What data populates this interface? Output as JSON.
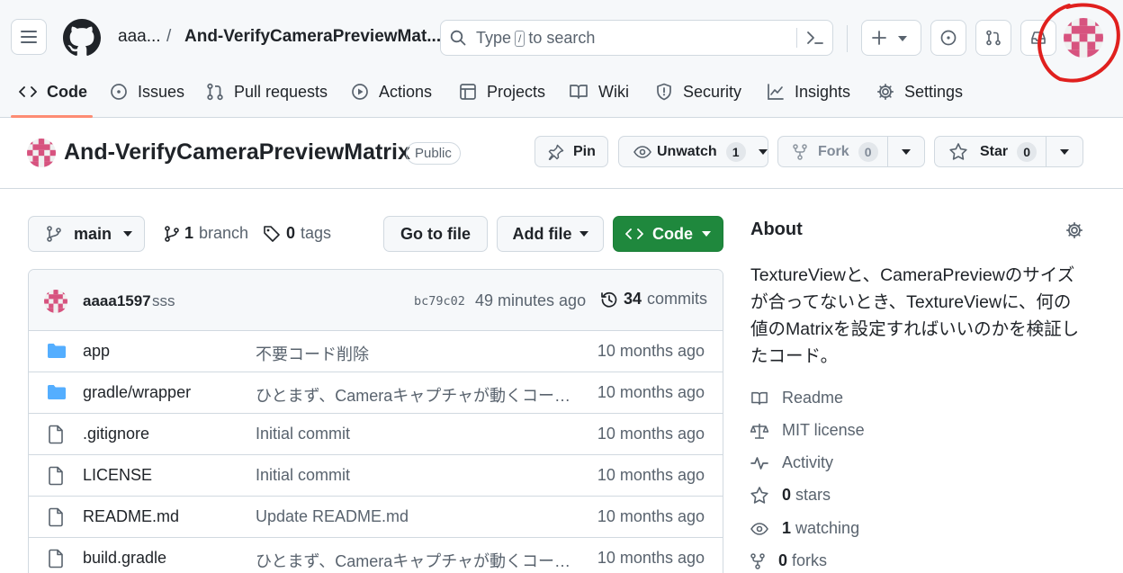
{
  "header": {
    "owner": "aaa...",
    "slash": "/",
    "repo_crumb": "And-VerifyCameraPreviewMat...",
    "search_type": "Type",
    "search_key": "/",
    "search_rest": "to search"
  },
  "tabs": [
    {
      "label": "Code"
    },
    {
      "label": "Issues"
    },
    {
      "label": "Pull requests"
    },
    {
      "label": "Actions"
    },
    {
      "label": "Projects"
    },
    {
      "label": "Wiki"
    },
    {
      "label": "Security"
    },
    {
      "label": "Insights"
    },
    {
      "label": "Settings"
    }
  ],
  "repo": {
    "name": "And-VerifyCameraPreviewMatrix",
    "visibility": "Public",
    "pin_label": "Pin",
    "unwatch_label": "Unwatch",
    "watch_count": "1",
    "fork_label": "Fork",
    "fork_count": "0",
    "star_label": "Star",
    "star_count": "0"
  },
  "branch_bar": {
    "branch": "main",
    "branch_count": "1",
    "branch_word": "branch",
    "tag_count": "0",
    "tag_word": "tags",
    "go_to_file": "Go to file",
    "add_file": "Add file",
    "code": "Code"
  },
  "latest_commit": {
    "author": "aaaa1597",
    "message": "sss",
    "sha": "bc79c02",
    "time": "49 minutes ago",
    "commit_count": "34",
    "commit_word": "commits"
  },
  "files": [
    {
      "type": "folder",
      "name": "app",
      "message": "不要コード削除",
      "time": "10 months ago"
    },
    {
      "type": "folder",
      "name": "gradle/wrapper",
      "message": "ひとまず、Cameraキャプチャが動くコード…",
      "time": "10 months ago"
    },
    {
      "type": "file",
      "name": ".gitignore",
      "message": "Initial commit",
      "time": "10 months ago"
    },
    {
      "type": "file",
      "name": "LICENSE",
      "message": "Initial commit",
      "time": "10 months ago"
    },
    {
      "type": "file",
      "name": "README.md",
      "message": "Update README.md",
      "time": "10 months ago"
    },
    {
      "type": "file",
      "name": "build.gradle",
      "message": "ひとまず、Cameraキャプチャが動くコード…",
      "time": "10 months ago"
    }
  ],
  "about": {
    "title": "About",
    "description": "TextureViewと、CameraPreviewのサイズが合ってないとき、TextureViewに、何の値のMatrixを設定すればいいのかを検証したコード。",
    "readme": "Readme",
    "license": "MIT license",
    "activity": "Activity",
    "stars_count": "0",
    "stars_word": "stars",
    "watching_count": "1",
    "watching_word": "watching",
    "forks_count": "0",
    "forks_word": "forks"
  },
  "colors": {
    "accent_green": "#1f883d",
    "tab_underline": "#fd8c73",
    "annotation_red": "#e0201e",
    "identicon_pink": "#d7537f"
  }
}
